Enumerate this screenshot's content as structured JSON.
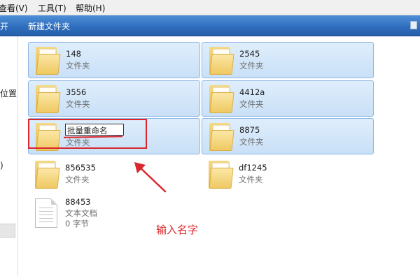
{
  "menubar": {
    "items": [
      "查看(V)",
      "工具(T)",
      "帮助(H)"
    ]
  },
  "toolbar": {
    "left_label": "开",
    "new_folder_label": "新建文件夹"
  },
  "navpane": {
    "items": [
      "位置",
      ")"
    ]
  },
  "files": [
    {
      "name": "148",
      "type": "文件夹"
    },
    {
      "name": "2545",
      "type": "文件夹"
    },
    {
      "name": "3556",
      "type": "文件夹"
    },
    {
      "name": "4412a",
      "type": "文件夹"
    },
    {
      "name": "批量重命名",
      "type": "文件夹"
    },
    {
      "name": "8875",
      "type": "文件夹"
    },
    {
      "name": "856535",
      "type": "文件夹"
    },
    {
      "name": "df1245",
      "type": "文件夹"
    },
    {
      "name": "88453",
      "type": "文本文档",
      "size": "0 字节"
    }
  ],
  "annotation": {
    "text": "输入名字",
    "color": "#d9272e"
  }
}
